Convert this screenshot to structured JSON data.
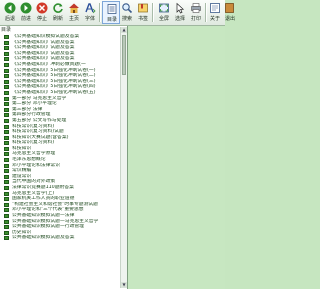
{
  "toolbar": {
    "buttons": [
      {
        "label": "后退",
        "icon": "back-arrow-icon"
      },
      {
        "label": "前进",
        "icon": "forward-arrow-icon"
      },
      {
        "label": "停止",
        "icon": "stop-icon"
      },
      {
        "label": "刷新",
        "icon": "refresh-icon"
      },
      {
        "label": "主页",
        "icon": "home-icon"
      },
      {
        "label": "字体",
        "icon": "font-icon"
      },
      {
        "label": "目录",
        "icon": "contents-icon"
      },
      {
        "label": "搜索",
        "icon": "search-icon"
      },
      {
        "label": "书签",
        "icon": "bookmark-icon"
      },
      {
        "label": "全屏",
        "icon": "fullscreen-icon"
      },
      {
        "label": "选择",
        "icon": "select-icon"
      },
      {
        "label": "打印",
        "icon": "print-icon"
      },
      {
        "label": "关于",
        "icon": "about-icon"
      },
      {
        "label": "退出",
        "icon": "exit-icon"
      }
    ],
    "accent": "#3e8f2f"
  },
  "tree": {
    "title": "目录",
    "items": [
      "《公共基础知识模拟试题及答案",
      "《公共基础知识》试题及答案",
      "《公共基础知识》试题及答案",
      "《公共基础知识》试题及答案",
      "《公共基础知识》试题及答案",
      "《公共基础知识》冲刺必做真题(一",
      "《公共基础知识》5日强化冲刺试卷(一)",
      "《公共基础知识》5日强化冲刺试卷(二)",
      "《公共基础知识》5日强化冲刺试卷(三)",
      "《公共基础知识》5日强化冲刺试卷(四)",
      "《公共基础知识》5日强化冲刺试卷(五)",
      "第一部分  马克思主义哲学",
      "第二部分  邓小平理论",
      "第三部分  法律",
      "第四部分行政管理",
      "第五部分  公文写作与处理",
      "科技常识(复习资料)",
      "科技常识(复习资料)试题",
      "科技知识大赛试题(含答案)",
      "科技常识(复习资料)",
      "科技知识",
      "马克思主义哲学原理",
      "毛泽东思想概论",
      "邓小平理论和法律常识",
      "常识精编",
      "建设常识",
      "当代中国的对外政策",
      "法律常识竞赛题110题附答案",
      "马克思主义哲学(上)",
      "国家机关工作人员的职业道德",
      "\"构建社会主义和谐社会\"时事专题测试题",
      "邓小平理论和\"三个代表\"重要思想",
      "公共基础知识模拟试题—法律",
      "公共基础知识模拟试题—马克思主义哲学",
      "公共基础知识模拟试题—行政管理",
      "历史知识",
      "公共基础知识模拟试题及答案"
    ]
  }
}
